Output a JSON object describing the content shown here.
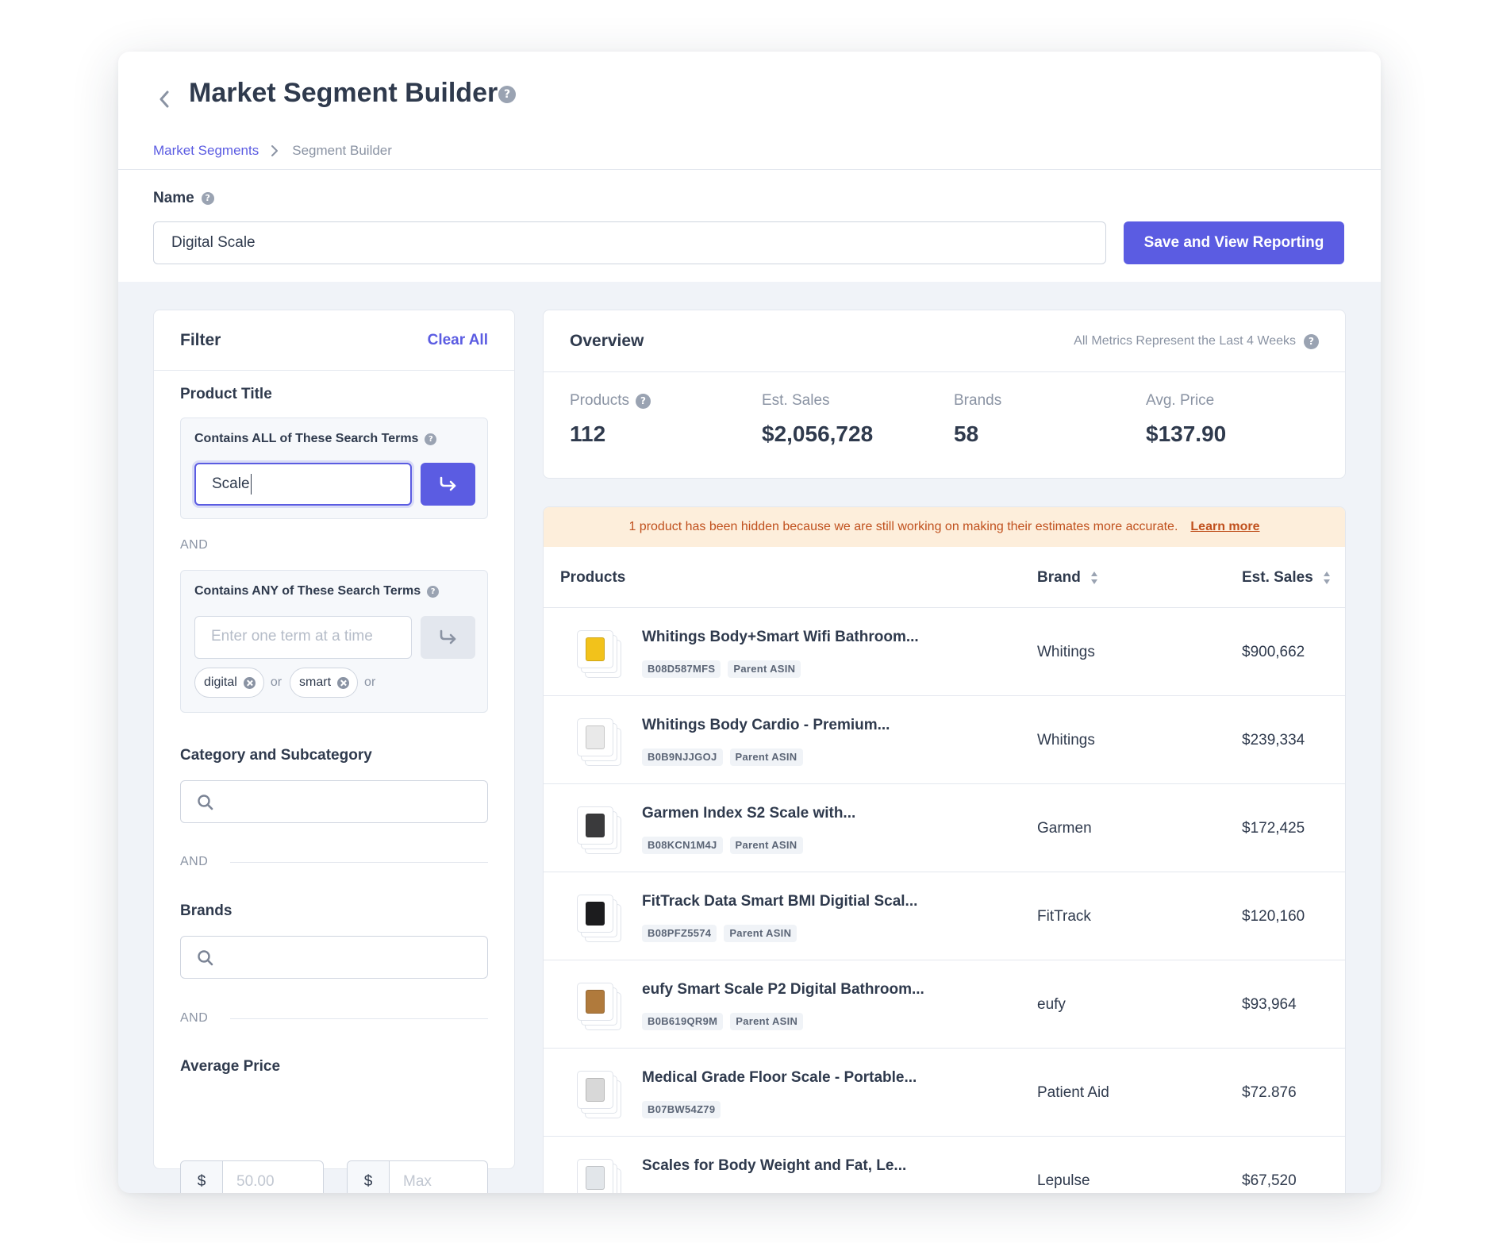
{
  "header": {
    "title": "Market Segment Builder",
    "breadcrumb": {
      "link": "Market Segments",
      "current": "Segment Builder"
    }
  },
  "name_section": {
    "label": "Name",
    "value": "Digital Scale",
    "save_label": "Save and View Reporting"
  },
  "filter": {
    "title": "Filter",
    "clear_label": "Clear All",
    "product_title": {
      "heading": "Product Title",
      "all_terms": {
        "label": "Contains ALL of These Search Terms",
        "value": "Scale"
      },
      "and_label": "AND",
      "any_terms": {
        "label": "Contains ANY of These Search Terms",
        "placeholder": "Enter one term at a time",
        "chips": [
          "digital",
          "smart"
        ],
        "or_label": "or"
      }
    },
    "category": {
      "heading": "Category and Subcategory",
      "and_label": "AND"
    },
    "brands": {
      "heading": "Brands",
      "and_label": "AND"
    },
    "price": {
      "heading": "Average Price",
      "currency": "$",
      "min_placeholder": "50.00",
      "max_placeholder": "Max",
      "separator": "-"
    }
  },
  "overview": {
    "title": "Overview",
    "note": "All Metrics Represent the Last 4 Weeks",
    "metrics": [
      {
        "label": "Products",
        "value": "112"
      },
      {
        "label": "Est. Sales",
        "value": "$2,056,728"
      },
      {
        "label": "Brands",
        "value": "58"
      },
      {
        "label": "Avg. Price",
        "value": "$137.90"
      }
    ]
  },
  "notice": {
    "text": "1 product has been hidden because we are still working on making their estimates more accurate.",
    "link": "Learn more"
  },
  "table": {
    "columns": {
      "products": "Products",
      "brand": "Brand",
      "sales": "Est. Sales"
    },
    "rows": [
      {
        "name": "Whitings Body+Smart Wifi Bathroom...",
        "asin": "B08D587MFS",
        "parent": "Parent ASIN",
        "brand": "Whitings",
        "sales": "$900,662",
        "thumb_color": "#f2c21b"
      },
      {
        "name": "Whitings Body Cardio - Premium...",
        "asin": "B0B9NJJGOJ",
        "parent": "Parent ASIN",
        "brand": "Whitings",
        "sales": "$239,334",
        "thumb_color": "#e9e9e9"
      },
      {
        "name": "Garmen Index S2 Scale with...",
        "asin": "B08KCN1M4J",
        "parent": "Parent ASIN",
        "brand": "Garmen",
        "sales": "$172,425",
        "thumb_color": "#3a3a3c"
      },
      {
        "name": "FitTrack Data Smart BMI Digitial Scal...",
        "asin": "B08PFZ5574",
        "parent": "Parent ASIN",
        "brand": "FitTrack",
        "sales": "$120,160",
        "thumb_color": "#1c1c1e"
      },
      {
        "name": "eufy Smart Scale P2 Digital Bathroom...",
        "asin": "B0B619QR9M",
        "parent": "Parent ASIN",
        "brand": "eufy",
        "sales": "$93,964",
        "thumb_color": "#b07a3c"
      },
      {
        "name": "Medical Grade Floor Scale - Portable...",
        "asin": "B07BW54Z79",
        "parent": "",
        "brand": "Patient Aid",
        "sales": "$72.876",
        "thumb_color": "#d8d8d8"
      },
      {
        "name": "Scales for Body Weight and Fat, Le...",
        "asin": "",
        "parent": "",
        "brand": "Lepulse",
        "sales": "$67,520",
        "thumb_color": "#e2e6ea"
      }
    ]
  },
  "colors": {
    "accent": "#5b5ce2",
    "notice_bg": "#fdeedb",
    "notice_text": "#c0501d"
  }
}
